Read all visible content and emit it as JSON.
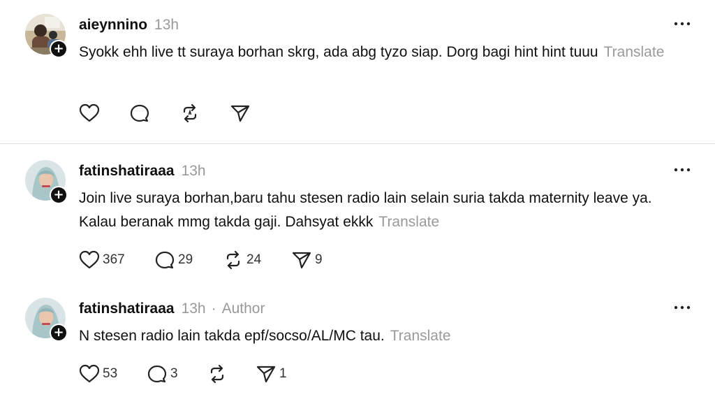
{
  "posts": [
    {
      "username": "aieynnino",
      "time": "13h",
      "author_label": "",
      "text": "Syokk ehh live tt suraya borhan skrg, ada abg tyzo siap. Dorg bagi hint hint tuuu",
      "translate_label": "Translate",
      "counts": {
        "like": "",
        "reply": "",
        "repost": "",
        "share": ""
      }
    },
    {
      "username": "fatinshatiraaa",
      "time": "13h",
      "author_label": "",
      "text": "Join live suraya borhan,baru tahu stesen radio lain selain suria takda maternity leave ya. Kalau beranak mmg takda gaji. Dahsyat ekkk",
      "translate_label": "Translate",
      "counts": {
        "like": "367",
        "reply": "29",
        "repost": "24",
        "share": "9"
      }
    },
    {
      "username": "fatinshatiraaa",
      "time": "13h",
      "separator": "·",
      "author_label": "Author",
      "text": "N stesen radio lain takda epf/socso/AL/MC tau.",
      "translate_label": "Translate",
      "counts": {
        "like": "53",
        "reply": "3",
        "repost": "",
        "share": "1"
      }
    }
  ],
  "icons": {
    "like": "heart-icon",
    "reply": "comment-icon",
    "repost": "repost-icon",
    "share": "send-icon",
    "more": "more-options-icon",
    "follow": "plus-icon"
  }
}
